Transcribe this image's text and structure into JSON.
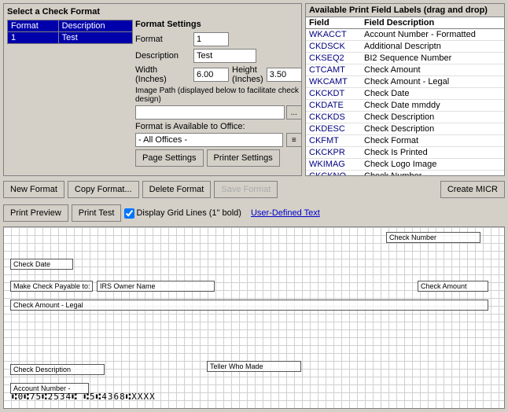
{
  "title": "Select a Check Format",
  "format_table": {
    "col1": "Format",
    "col2": "Description",
    "rows": [
      {
        "format": "1",
        "description": "Test",
        "selected": true
      }
    ]
  },
  "settings": {
    "title": "Format Settings",
    "format_label": "Format",
    "format_value": "1",
    "description_label": "Description",
    "description_value": "Test",
    "width_label": "Width (Inches)",
    "width_value": "6.00",
    "height_label": "Height (Inches)",
    "height_value": "3.50",
    "image_path_label": "Image Path (displayed below to facilitate check design)",
    "image_path_value": "",
    "office_label": "Format is Available to Office:",
    "office_value": "- All Offices -",
    "page_settings_btn": "Page Settings",
    "printer_settings_btn": "Printer Settings"
  },
  "format_actions": {
    "new_format": "New Format",
    "copy_format": "Copy Format...",
    "delete_format": "Delete Format",
    "save_format": "Save Format",
    "create_micr": "Create MICR"
  },
  "toolbar": {
    "print_preview": "Print Preview",
    "print_test": "Print Test",
    "display_grid": "Display Grid Lines (1\" bold)",
    "user_defined": "User-Defined Text"
  },
  "available_fields": {
    "title": "Available Print Field Labels (drag and drop)",
    "col_field": "Field",
    "col_desc": "Field Description",
    "rows": [
      {
        "code": "WKACCT",
        "desc": "Account Number - Formatted"
      },
      {
        "code": "CKDSCK",
        "desc": "Additional Descriptn"
      },
      {
        "code": "CKSEQ2",
        "desc": "BI2 Sequence Number"
      },
      {
        "code": "CTCAMT",
        "desc": "Check Amount"
      },
      {
        "code": "WKCAMT",
        "desc": "Check Amount - Legal"
      },
      {
        "code": "CKCKDT",
        "desc": "Check Date"
      },
      {
        "code": "CKDATE",
        "desc": "Check Date mmddy"
      },
      {
        "code": "CKCKDS",
        "desc": "Check Description"
      },
      {
        "code": "CKDESC",
        "desc": "Check Description"
      },
      {
        "code": "CKFMT",
        "desc": "Check Format"
      },
      {
        "code": "CKCKPR",
        "desc": "Check Is Printed"
      },
      {
        "code": "WKIMAG",
        "desc": "Check Logo Image"
      },
      {
        "code": "CKCKNO",
        "desc": "Check Number"
      }
    ]
  },
  "check_fields": {
    "check_number": "Check Number",
    "check_date": "Check Date",
    "make_payable": "Make Check Payable to:",
    "irs_owner": "IRS Owner Name",
    "check_amount": "Check Amount",
    "check_amount_legal": "Check Amount - Legal",
    "teller_who_made": "Teller Who Made",
    "check_description": "Check Description",
    "account_number": "Account Number -",
    "micr_line": "⑆0⑆75⑆2534⑆  ⑆5⑆4368⑆XXXX"
  }
}
